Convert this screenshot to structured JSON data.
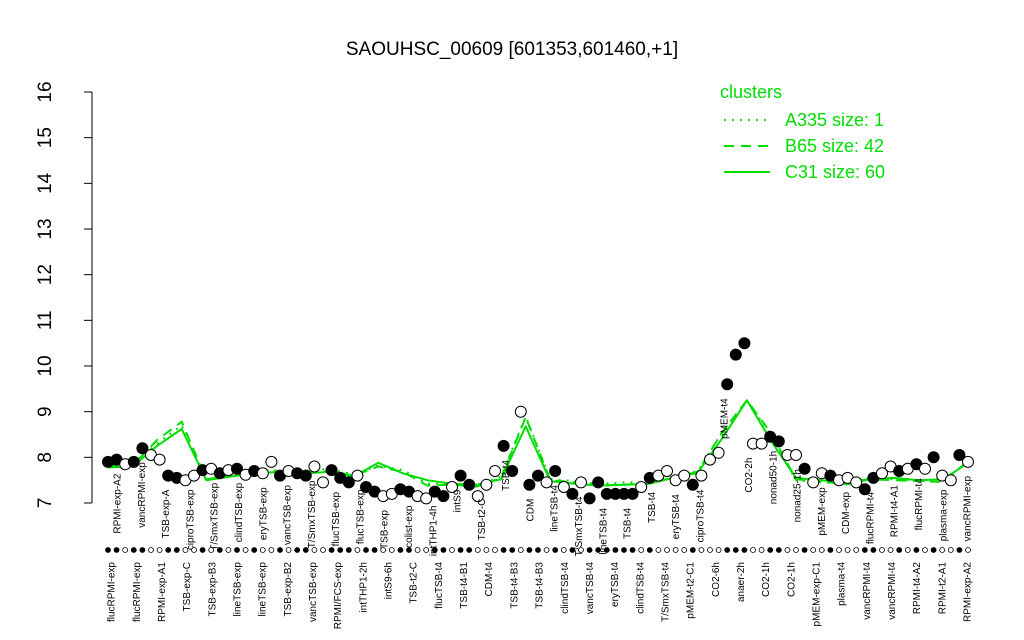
{
  "chart_data": {
    "type": "line",
    "title": "SAOUHSC_00609 [601353,601460,+1]",
    "xlabel": "",
    "ylabel": "",
    "ylim": [
      7,
      16
    ],
    "yticks": [
      7,
      8,
      9,
      10,
      11,
      12,
      13,
      14,
      15,
      16
    ],
    "grid": false,
    "legend": {
      "placement": "top-right",
      "title": "clusters",
      "color": "#00dd00",
      "entries": [
        {
          "label": "A335 size: 1",
          "style": "dotted"
        },
        {
          "label": "B65 size: 42",
          "style": "dashed"
        },
        {
          "label": "C31 size: 60",
          "style": "solid"
        }
      ]
    },
    "bottom_labels": [
      "flucRPMI-exp",
      "flucRPMI-exp",
      "RPMI-exp-A1",
      "TSB-exp-C",
      "TSB-exp-B3",
      "lineTSB-exp",
      "lineTSB-exp",
      "TSB-exp-B2",
      "vancTSB-exp",
      "RPMI/FCS-exp",
      "intTHP1-2h",
      "intS9-6h",
      "TSB-t2-C",
      "flucTSB-t4",
      "TSB-t4-B1",
      "CDM-t4",
      "TSB-t4-B3",
      "TSB-t4-B3",
      "clindTSB-t4",
      "vancTSB-t4",
      "eryTSB-t4",
      "clindTSB-t4",
      "T/SmxTSB-t4",
      "pMEM-t2-C1",
      "CO2-6h",
      "anaer-2h",
      "CO2-1h",
      "CO2-1h",
      "pMEM-exp-C1",
      "plasma-t4",
      "vancRPMI-t4",
      "vancRPMI-t4",
      "RPMI-t4-A2",
      "RPMI-t2-A1",
      "RPMI-exp-A2"
    ],
    "point_labels": [
      "RPMI-exp-A2",
      "vancRPMI-exp",
      "TSB-exp-A",
      "ciproTSB-exp",
      "T/SmxTSB-exp",
      "clindTSB-exp",
      "eryTSB-exp",
      "vancTSB-exp",
      "T/SmxTSB-exp",
      "flucTSB-exp",
      "flucTSB-exp",
      "TSB-exp",
      "colist-exp",
      "intTHP1-4h",
      "intS9",
      "TSB-t2-C",
      "TSB-t4",
      "CDM",
      "lineTSB-t4",
      "T/SmxTSB-t4",
      "lineTSB-t4",
      "TSB-t4",
      "TSB-t4",
      "eryTSB-t4",
      "ciproTSB-t4",
      "pMEM-t4",
      "CO2-2h",
      "nonad50-1h",
      "nonad25-1h",
      "pMEM-exp",
      "CDM-exp",
      "flucRPMI-t4",
      "RPMI-t4-A1",
      "flucRPMI-t4",
      "plasma-exp",
      "vancRPMI-exp"
    ],
    "series": [
      {
        "name": "A335 size: 1",
        "style": "dotted",
        "values": [
          7.88,
          7.86,
          8.3,
          8.7,
          7.5,
          7.62,
          7.7,
          7.72,
          7.7,
          7.75,
          7.62,
          7.82,
          7.72,
          7.42,
          7.42,
          7.38,
          7.58,
          8.9,
          7.52,
          7.48,
          7.42,
          7.45,
          7.45,
          7.58,
          7.7,
          8.55,
          9.25,
          8.48,
          7.5,
          7.45,
          7.42,
          7.55,
          7.52,
          7.48,
          7.5,
          7.9
        ]
      },
      {
        "name": "B65 size: 42",
        "style": "dashed",
        "values": [
          7.82,
          7.82,
          8.38,
          8.78,
          7.52,
          7.6,
          7.66,
          7.7,
          7.68,
          7.7,
          7.6,
          7.8,
          7.68,
          7.38,
          7.4,
          7.36,
          7.55,
          8.88,
          7.5,
          7.45,
          7.38,
          7.4,
          7.42,
          7.56,
          7.68,
          8.55,
          9.25,
          8.52,
          7.52,
          7.48,
          7.4,
          7.52,
          7.5,
          7.48,
          7.46,
          7.92
        ]
      },
      {
        "name": "C31 size: 60",
        "style": "solid",
        "values": [
          7.78,
          7.8,
          8.25,
          8.62,
          7.5,
          7.58,
          7.65,
          7.68,
          7.65,
          7.68,
          7.58,
          7.88,
          7.65,
          7.5,
          7.42,
          7.4,
          7.52,
          8.68,
          7.48,
          7.42,
          7.38,
          7.4,
          7.42,
          7.55,
          7.66,
          8.42,
          9.25,
          8.35,
          7.55,
          7.5,
          7.45,
          7.52,
          7.55,
          7.5,
          7.52,
          7.88
        ]
      }
    ],
    "points": [
      {
        "x": 1,
        "y": 7.9,
        "filled": true
      },
      {
        "x": 2,
        "y": 7.95,
        "filled": true
      },
      {
        "x": 3,
        "y": 7.85,
        "filled": false
      },
      {
        "x": 4,
        "y": 7.9,
        "filled": true
      },
      {
        "x": 5,
        "y": 8.2,
        "filled": true
      },
      {
        "x": 6,
        "y": 8.05,
        "filled": false
      },
      {
        "x": 7,
        "y": 7.95,
        "filled": false
      },
      {
        "x": 8,
        "y": 7.6,
        "filled": true
      },
      {
        "x": 9,
        "y": 7.55,
        "filled": true
      },
      {
        "x": 10,
        "y": 7.5,
        "filled": false
      },
      {
        "x": 11,
        "y": 7.6,
        "filled": false
      },
      {
        "x": 12,
        "y": 7.72,
        "filled": true
      },
      {
        "x": 13,
        "y": 7.75,
        "filled": false
      },
      {
        "x": 14,
        "y": 7.65,
        "filled": true
      },
      {
        "x": 15,
        "y": 7.72,
        "filled": false
      },
      {
        "x": 16,
        "y": 7.75,
        "filled": true
      },
      {
        "x": 17,
        "y": 7.62,
        "filled": false
      },
      {
        "x": 18,
        "y": 7.7,
        "filled": true
      },
      {
        "x": 19,
        "y": 7.65,
        "filled": false
      },
      {
        "x": 20,
        "y": 7.9,
        "filled": false
      },
      {
        "x": 21,
        "y": 7.6,
        "filled": true
      },
      {
        "x": 22,
        "y": 7.7,
        "filled": false
      },
      {
        "x": 23,
        "y": 7.65,
        "filled": true
      },
      {
        "x": 24,
        "y": 7.6,
        "filled": true
      },
      {
        "x": 25,
        "y": 7.8,
        "filled": false
      },
      {
        "x": 26,
        "y": 7.45,
        "filled": false
      },
      {
        "x": 27,
        "y": 7.72,
        "filled": true
      },
      {
        "x": 28,
        "y": 7.55,
        "filled": true
      },
      {
        "x": 29,
        "y": 7.45,
        "filled": true
      },
      {
        "x": 30,
        "y": 7.6,
        "filled": false
      },
      {
        "x": 31,
        "y": 7.35,
        "filled": true
      },
      {
        "x": 32,
        "y": 7.25,
        "filled": true
      },
      {
        "x": 33,
        "y": 7.15,
        "filled": false
      },
      {
        "x": 34,
        "y": 7.2,
        "filled": false
      },
      {
        "x": 35,
        "y": 7.3,
        "filled": true
      },
      {
        "x": 36,
        "y": 7.25,
        "filled": true
      },
      {
        "x": 37,
        "y": 7.15,
        "filled": false
      },
      {
        "x": 38,
        "y": 7.1,
        "filled": false
      },
      {
        "x": 39,
        "y": 7.25,
        "filled": true
      },
      {
        "x": 40,
        "y": 7.15,
        "filled": true
      },
      {
        "x": 41,
        "y": 7.35,
        "filled": false
      },
      {
        "x": 42,
        "y": 7.6,
        "filled": true
      },
      {
        "x": 43,
        "y": 7.4,
        "filled": true
      },
      {
        "x": 44,
        "y": 7.15,
        "filled": false
      },
      {
        "x": 45,
        "y": 7.4,
        "filled": false
      },
      {
        "x": 46,
        "y": 7.7,
        "filled": false
      },
      {
        "x": 47,
        "y": 8.25,
        "filled": true
      },
      {
        "x": 48,
        "y": 7.7,
        "filled": true
      },
      {
        "x": 49,
        "y": 9.0,
        "filled": false
      },
      {
        "x": 50,
        "y": 7.4,
        "filled": true
      },
      {
        "x": 51,
        "y": 7.6,
        "filled": true
      },
      {
        "x": 52,
        "y": 7.45,
        "filled": false
      },
      {
        "x": 53,
        "y": 7.7,
        "filled": true
      },
      {
        "x": 54,
        "y": 7.35,
        "filled": false
      },
      {
        "x": 55,
        "y": 7.2,
        "filled": true
      },
      {
        "x": 56,
        "y": 7.45,
        "filled": false
      },
      {
        "x": 57,
        "y": 7.1,
        "filled": true
      },
      {
        "x": 58,
        "y": 7.45,
        "filled": true
      },
      {
        "x": 59,
        "y": 7.2,
        "filled": true
      },
      {
        "x": 60,
        "y": 7.2,
        "filled": true
      },
      {
        "x": 61,
        "y": 7.2,
        "filled": true
      },
      {
        "x": 62,
        "y": 7.2,
        "filled": true
      },
      {
        "x": 63,
        "y": 7.35,
        "filled": false
      },
      {
        "x": 64,
        "y": 7.55,
        "filled": true
      },
      {
        "x": 65,
        "y": 7.6,
        "filled": false
      },
      {
        "x": 66,
        "y": 7.7,
        "filled": false
      },
      {
        "x": 67,
        "y": 7.5,
        "filled": false
      },
      {
        "x": 68,
        "y": 7.6,
        "filled": false
      },
      {
        "x": 69,
        "y": 7.4,
        "filled": true
      },
      {
        "x": 70,
        "y": 7.6,
        "filled": false
      },
      {
        "x": 71,
        "y": 7.95,
        "filled": false
      },
      {
        "x": 72,
        "y": 8.1,
        "filled": false
      },
      {
        "x": 73,
        "y": 9.6,
        "filled": true
      },
      {
        "x": 74,
        "y": 10.25,
        "filled": true
      },
      {
        "x": 75,
        "y": 10.5,
        "filled": true
      },
      {
        "x": 76,
        "y": 8.3,
        "filled": false
      },
      {
        "x": 77,
        "y": 8.3,
        "filled": false
      },
      {
        "x": 78,
        "y": 8.45,
        "filled": true
      },
      {
        "x": 79,
        "y": 8.35,
        "filled": true
      },
      {
        "x": 80,
        "y": 8.05,
        "filled": false
      },
      {
        "x": 81,
        "y": 8.05,
        "filled": false
      },
      {
        "x": 82,
        "y": 7.75,
        "filled": true
      },
      {
        "x": 83,
        "y": 7.45,
        "filled": false
      },
      {
        "x": 84,
        "y": 7.65,
        "filled": false
      },
      {
        "x": 85,
        "y": 7.6,
        "filled": true
      },
      {
        "x": 86,
        "y": 7.5,
        "filled": false
      },
      {
        "x": 87,
        "y": 7.55,
        "filled": false
      },
      {
        "x": 88,
        "y": 7.45,
        "filled": false
      },
      {
        "x": 89,
        "y": 7.3,
        "filled": true
      },
      {
        "x": 90,
        "y": 7.55,
        "filled": true
      },
      {
        "x": 91,
        "y": 7.65,
        "filled": false
      },
      {
        "x": 92,
        "y": 7.8,
        "filled": false
      },
      {
        "x": 93,
        "y": 7.7,
        "filled": true
      },
      {
        "x": 94,
        "y": 7.75,
        "filled": false
      },
      {
        "x": 95,
        "y": 7.85,
        "filled": true
      },
      {
        "x": 96,
        "y": 7.75,
        "filled": false
      },
      {
        "x": 97,
        "y": 8.0,
        "filled": true
      },
      {
        "x": 98,
        "y": 7.6,
        "filled": false
      },
      {
        "x": 99,
        "y": 7.5,
        "filled": false
      },
      {
        "x": 100,
        "y": 8.05,
        "filled": true
      },
      {
        "x": 101,
        "y": 7.9,
        "filled": false
      }
    ]
  }
}
